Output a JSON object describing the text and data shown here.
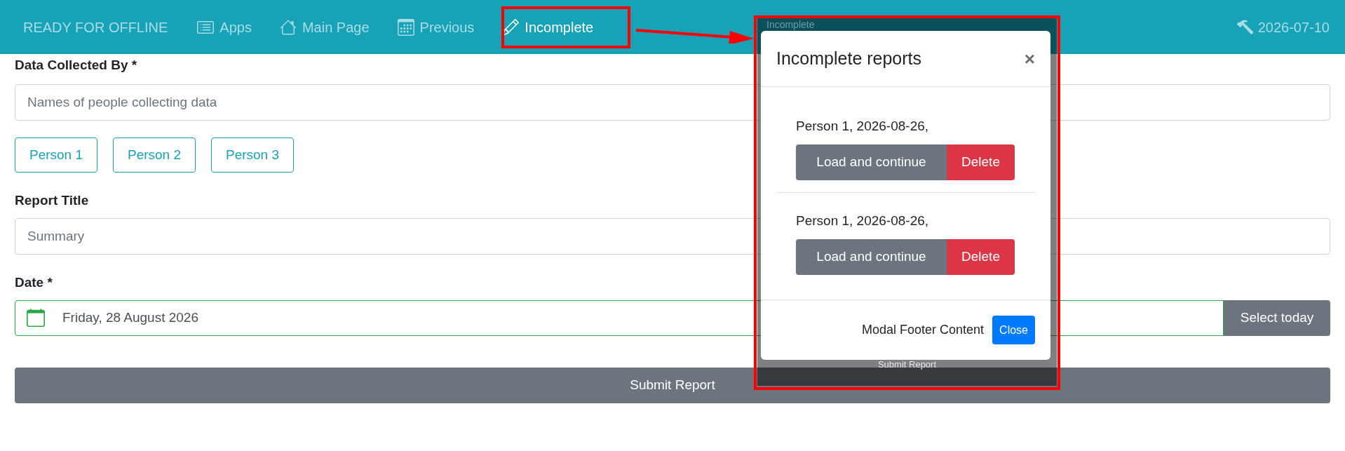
{
  "navbar": {
    "brand": "READY FOR OFFLINE",
    "items": [
      {
        "label": "Apps",
        "selected": false
      },
      {
        "label": "Main Page",
        "selected": false
      },
      {
        "label": "Previous",
        "selected": false
      },
      {
        "label": "Incomplete",
        "selected": true
      }
    ],
    "date": "2026-07-10"
  },
  "form": {
    "collected_by": {
      "label": "Data Collected By *",
      "placeholder": "Names of people collecting data",
      "quick_picks": [
        "Person 1",
        "Person 2",
        "Person 3"
      ]
    },
    "report_title": {
      "label": "Report Title",
      "placeholder": "Summary"
    },
    "date": {
      "label": "Date *",
      "value": "Friday, 28 August 2026",
      "button": "Select today"
    },
    "submit": "Submit Report"
  },
  "modal": {
    "backdrop_top": "Incomplete",
    "backdrop_bottom": "Submit Report",
    "title": "Incomplete reports",
    "close_icon": "×",
    "items": [
      {
        "text": "Person 1, 2026-08-26,",
        "load": "Load and continue",
        "delete": "Delete"
      },
      {
        "text": "Person 1, 2026-08-26,",
        "load": "Load and continue",
        "delete": "Delete"
      }
    ],
    "footer_text": "Modal Footer Content",
    "close": "Close"
  }
}
